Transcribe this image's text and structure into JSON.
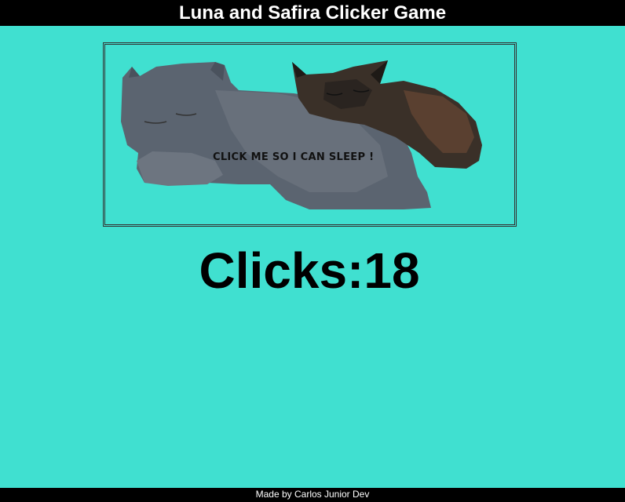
{
  "header": {
    "title": "Luna and Safira Clicker Game"
  },
  "cat_button": {
    "caption": "CLICK ME SO I CAN SLEEP !"
  },
  "counter": {
    "text": "Clicks:18",
    "label": "Clicks",
    "value": 18
  },
  "footer": {
    "credit": "Made by Carlos Junior Dev"
  },
  "colors": {
    "background": "#40E0D0",
    "header_bg": "#000000",
    "header_text": "#FFFFFF",
    "counter_text": "#000000"
  }
}
